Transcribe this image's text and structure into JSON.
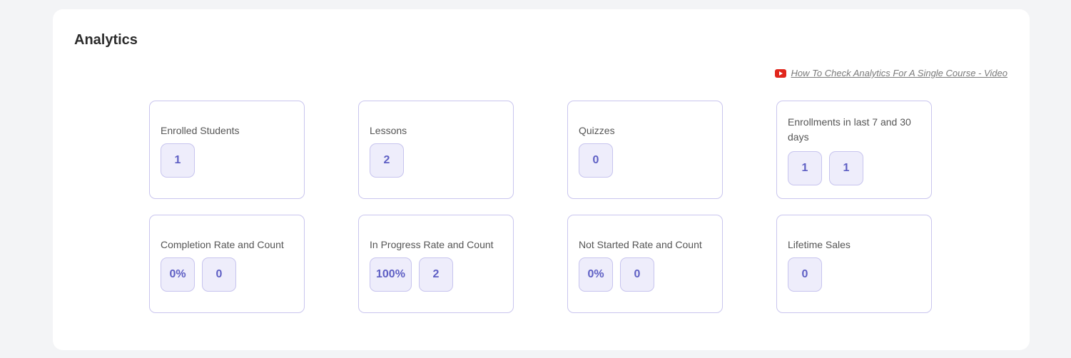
{
  "title": "Analytics",
  "video_link": {
    "icon": "youtube-icon",
    "text": "How To Check Analytics For A Single Course - Video"
  },
  "cards": [
    {
      "label": "Enrolled Students",
      "values": [
        "1"
      ]
    },
    {
      "label": "Lessons",
      "values": [
        "2"
      ]
    },
    {
      "label": "Quizzes",
      "values": [
        "0"
      ]
    },
    {
      "label": "Enrollments in last 7 and 30 days",
      "values": [
        "1",
        "1"
      ]
    },
    {
      "label": "Completion Rate and Count",
      "values": [
        "0%",
        "0"
      ]
    },
    {
      "label": "In Progress Rate and Count",
      "values": [
        "100%",
        "2"
      ]
    },
    {
      "label": "Not Started Rate and Count",
      "values": [
        "0%",
        "0"
      ]
    },
    {
      "label": "Lifetime Sales",
      "values": [
        "0"
      ]
    }
  ],
  "colors": {
    "accent": "#5e5fc4",
    "chip_bg": "#eeedfb",
    "card_border": "#c9c5ee",
    "youtube_red": "#e1261c"
  }
}
